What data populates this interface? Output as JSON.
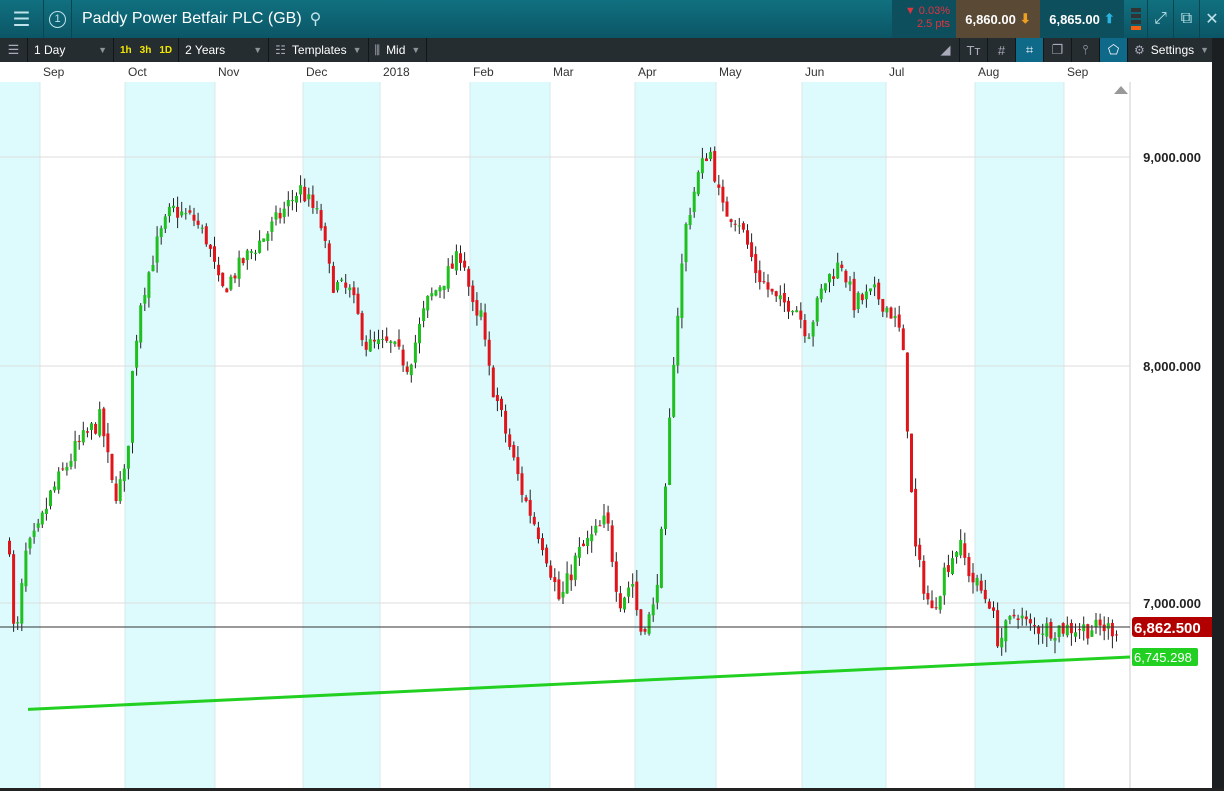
{
  "header": {
    "title": "Paddy Power Betfair PLC (GB)",
    "window_number": "1",
    "change_pct": "0.03%",
    "change_pts": "2.5 pts",
    "sell_price": "6,860.00",
    "buy_price": "6,865.00"
  },
  "toolbar": {
    "interval": "1 Day",
    "quick": [
      "1h",
      "3h",
      "1D"
    ],
    "range": "2 Years",
    "templates": "Templates",
    "price_type": "Mid",
    "settings": "Settings"
  },
  "colors": {
    "up": "#1fbf1f",
    "down": "#e0151b",
    "band": "#ddfbfd",
    "trend": "#22d022",
    "last": "#b20000"
  },
  "chart_data": {
    "type": "candlestick",
    "months": [
      "Sep",
      "Oct",
      "Nov",
      "Dec",
      "2018",
      "Feb",
      "Mar",
      "Apr",
      "May",
      "Jun",
      "Jul",
      "Aug",
      "Sep"
    ],
    "y_ticks": [
      "9,000.000",
      "8,000.000",
      "7,000.000"
    ],
    "y_tick_values": [
      9000,
      8000,
      7000
    ],
    "last_price": 6862.5,
    "last_price_label": "6,862.500",
    "trendline": {
      "start": 6650,
      "end": 6745.298,
      "end_label": "6,745.298"
    },
    "close_path_by_month_fraction": [
      [
        0,
        7250
      ],
      [
        0.1,
        6900
      ],
      [
        0.2,
        6760
      ],
      [
        0.3,
        6950
      ],
      [
        0.5,
        7200
      ],
      [
        0.9,
        7300
      ],
      [
        1.1,
        7450
      ],
      [
        1.4,
        7650
      ],
      [
        1.7,
        7780
      ],
      [
        1.85,
        7450
      ],
      [
        2,
        7550
      ],
      [
        2.05,
        7900
      ],
      [
        2.15,
        8300
      ],
      [
        2.35,
        8600
      ],
      [
        2.5,
        8750
      ],
      [
        2.75,
        8700
      ],
      [
        2.9,
        8600
      ],
      [
        3.05,
        8350
      ],
      [
        3.3,
        8500
      ],
      [
        3.6,
        8650
      ],
      [
        3.95,
        8850
      ],
      [
        4.2,
        8700
      ],
      [
        4.35,
        8400
      ],
      [
        4.6,
        8350
      ],
      [
        4.8,
        8100
      ],
      [
        5.1,
        8100
      ],
      [
        5.3,
        8000
      ],
      [
        5.5,
        8300
      ],
      [
        5.75,
        8450
      ],
      [
        5.9,
        8550
      ],
      [
        6.05,
        8200
      ],
      [
        6.12,
        8250
      ],
      [
        6.2,
        8000
      ],
      [
        6.4,
        7750
      ],
      [
        6.65,
        7450
      ],
      [
        6.9,
        7250
      ],
      [
        7.1,
        7000
      ],
      [
        7.3,
        7200
      ],
      [
        7.65,
        7350
      ],
      [
        7.8,
        7000
      ],
      [
        7.95,
        7100
      ],
      [
        8.05,
        6850
      ],
      [
        8.2,
        6950
      ],
      [
        8.35,
        7400
      ],
      [
        8.45,
        8000
      ],
      [
        8.6,
        8650
      ],
      [
        8.75,
        8900
      ],
      [
        8.9,
        9050
      ],
      [
        9.05,
        8750
      ],
      [
        9.25,
        8700
      ],
      [
        9.45,
        8450
      ],
      [
        9.7,
        8300
      ],
      [
        9.9,
        8300
      ],
      [
        10.05,
        8150
      ],
      [
        10.25,
        8400
      ],
      [
        10.45,
        8500
      ],
      [
        10.6,
        8300
      ],
      [
        10.85,
        8350
      ],
      [
        11.05,
        8250
      ],
      [
        11.15,
        8150
      ],
      [
        11.2,
        7950
      ],
      [
        11.25,
        7550
      ],
      [
        11.32,
        7200
      ],
      [
        11.5,
        6950
      ],
      [
        11.65,
        7150
      ],
      [
        11.8,
        7250
      ],
      [
        11.95,
        7100
      ],
      [
        12.15,
        7000
      ],
      [
        12.25,
        6800
      ],
      [
        12.45,
        6950
      ],
      [
        12.6,
        6862.5
      ]
    ]
  }
}
